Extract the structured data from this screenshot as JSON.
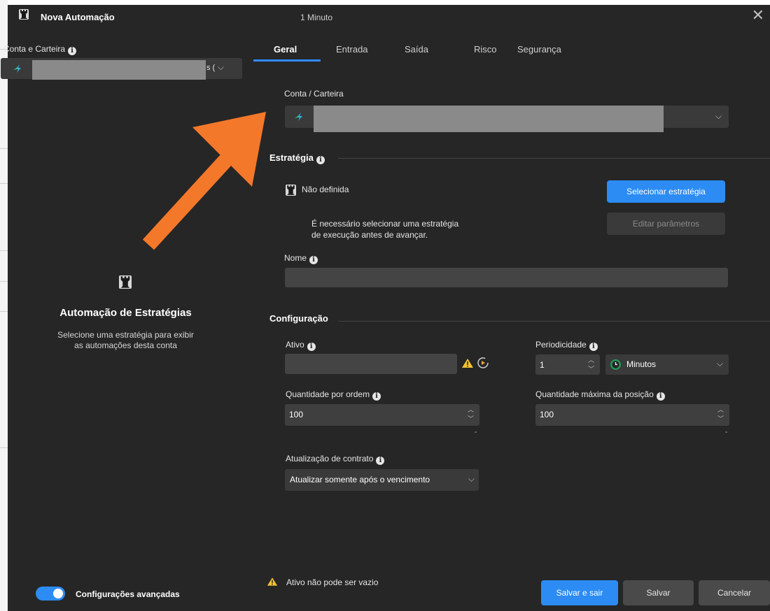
{
  "window": {
    "title": "Nova Automação",
    "periodicity_caption": "1 Minuto",
    "close_label": "✕"
  },
  "left": {
    "account_label": "Conta e Carteira",
    "account_suffix": "s (",
    "empty_title": "Automação de Estratégias",
    "empty_text_1": "Selecione uma estratégia para exibir",
    "empty_text_2": "as automações desta conta"
  },
  "tabs": [
    {
      "label": "Geral",
      "active": true
    },
    {
      "label": "Entrada",
      "active": false
    },
    {
      "label": "Saída",
      "active": false
    },
    {
      "label": "Risco",
      "active": false
    },
    {
      "label": "Segurança",
      "active": false
    }
  ],
  "geral": {
    "account_field_label": "Conta / Carteira",
    "strategy_section": "Estratégia",
    "strategy_status": "Não definida",
    "select_strategy_button": "Selecionar estratégia",
    "edit_params_button": "Editar parâmetros",
    "strategy_note_1": "É necessário selecionar uma estratégia",
    "strategy_note_2": "de execução antes de avançar.",
    "name_label": "Nome",
    "name_value": "",
    "config_section": "Configuração",
    "asset_label": "Ativo",
    "asset_value": "",
    "periodicity_label": "Periodicidade",
    "periodicity_value": "1",
    "periodicity_unit": "Minutos",
    "qty_order_label": "Quantidade por ordem",
    "qty_order_value": "100",
    "qty_max_label": "Quantidade máxima da posição",
    "qty_max_value": "100",
    "dash": "-",
    "contract_update_label": "Atualização de contrato",
    "contract_update_value": "Atualizar somente após o vencimento"
  },
  "footer": {
    "advanced_label": "Configurações avançadas",
    "advanced_enabled": true,
    "warning_text": "Ativo não pode ser vazio",
    "save_exit_button": "Salvar e sair",
    "save_button": "Salvar",
    "cancel_button": "Cancelar"
  },
  "colors": {
    "accent": "#2c8cf4",
    "arrow": "#f4782a",
    "background": "#262626",
    "warning": "#f2c230"
  },
  "icons": {
    "window": "rook-icon",
    "close": "close-icon",
    "info": "info-icon",
    "chevron": "chevron-down-icon",
    "warning": "warning-icon",
    "clock": "clock-icon",
    "refresh": "refresh-icon",
    "broker": "broker-logo-icon",
    "annotation": "orange-arrow-icon"
  }
}
